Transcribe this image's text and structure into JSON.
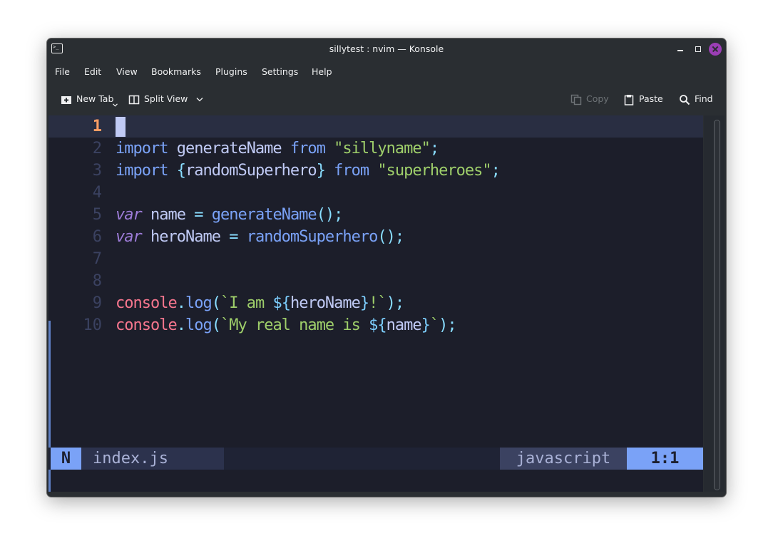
{
  "window": {
    "title": "sillytest : nvim — Konsole"
  },
  "menubar": {
    "items": [
      "File",
      "Edit",
      "View",
      "Bookmarks",
      "Plugins",
      "Settings",
      "Help"
    ]
  },
  "toolbar": {
    "new_tab": "New Tab",
    "split_view": "Split View",
    "copy": "Copy",
    "paste": "Paste",
    "find": "Find"
  },
  "editor": {
    "line_numbers": [
      "1",
      "2",
      "3",
      "4",
      "5",
      "6",
      "7",
      "8",
      "9",
      "10"
    ],
    "lines": {
      "l2": {
        "t1": "import",
        "t2": " generateName ",
        "t3": "from",
        "t4": " ",
        "t5": "\"sillyname\"",
        "t6": ";"
      },
      "l3": {
        "t1": "import",
        "t2": " ",
        "t3": "{",
        "t4": "randomSuperhero",
        "t5": "}",
        "t6": " ",
        "t7": "from",
        "t8": " ",
        "t9": "\"superheroes\"",
        "t10": ";"
      },
      "l5": {
        "t1": "var",
        "t2": " name ",
        "t3": "=",
        "t4": " ",
        "t5": "generateName",
        "t6": "();"
      },
      "l6": {
        "t1": "var",
        "t2": " heroName ",
        "t3": "=",
        "t4": " ",
        "t5": "randomSuperhero",
        "t6": "();"
      },
      "l9": {
        "t1": "console",
        "t2": ".",
        "t3": "log",
        "t4": "(",
        "t5": "`I am ",
        "t6": "${",
        "t7": "heroName",
        "t8": "}",
        "t9": "!`",
        "t10": ");"
      },
      "l10": {
        "t1": "console",
        "t2": ".",
        "t3": "log",
        "t4": "(",
        "t5": "`My real name is ",
        "t6": "${",
        "t7": "name",
        "t8": "}",
        "t9": "`",
        "t10": ");"
      }
    }
  },
  "statusline": {
    "mode": "N",
    "filename": "index.js",
    "filetype": "javascript",
    "position": "1:1"
  },
  "colors": {
    "keyword": "#7aa2f7",
    "storage_italic": "#9d7cd8",
    "string": "#9ece6a",
    "console": "#f7768e",
    "punctuation": "#89ddff",
    "close_button": "#9b3eb5",
    "mode_bg": "#7aa2f7"
  },
  "icons": {
    "app": "terminal-icon",
    "new_tab": "new-tab-icon",
    "split_view": "split-view-icon",
    "copy": "copy-icon",
    "paste": "clipboard-icon",
    "find": "search-icon"
  }
}
